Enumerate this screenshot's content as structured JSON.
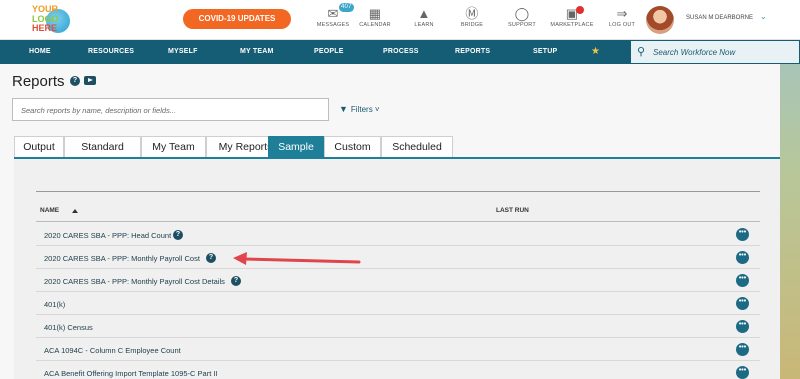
{
  "logo": {
    "line1": "YOUR",
    "line2": "LOGO",
    "line3": "HERE"
  },
  "covid_button": "COVID-19 UPDATES",
  "top_icons": [
    {
      "label": "MESSAGES",
      "icon": "inbox-icon",
      "badge": "407"
    },
    {
      "label": "CALENDAR",
      "icon": "calendar-icon"
    },
    {
      "label": "LEARN",
      "icon": "graduation-cap-icon"
    },
    {
      "label": "BRIDGE",
      "icon": "bridge-icon"
    },
    {
      "label": "SUPPORT",
      "icon": "support-chat-icon"
    },
    {
      "label": "MARKETPLACE",
      "icon": "marketplace-icon"
    },
    {
      "label": "LOG OUT",
      "icon": "logout-icon"
    }
  ],
  "user": {
    "name": "SUSAN M DEARBORNE"
  },
  "nav": {
    "items": [
      "HOME",
      "RESOURCES",
      "MYSELF",
      "MY TEAM",
      "PEOPLE",
      "PROCESS",
      "REPORTS",
      "SETUP"
    ],
    "search_placeholder": "Search Workforce Now"
  },
  "page": {
    "title": "Reports",
    "search_placeholder": "Search reports by name, description or fields...",
    "filters_label": "Filters"
  },
  "tabs": [
    "Output",
    "Standard",
    "My Team",
    "My Reports",
    "Sample",
    "Custom",
    "Scheduled"
  ],
  "active_tab": "Sample",
  "table": {
    "columns": [
      "NAME",
      "LAST RUN"
    ],
    "rows": [
      {
        "name": "2020 CARES SBA - PPP: Head Count",
        "help": true
      },
      {
        "name": "2020 CARES SBA - PPP: Monthly Payroll Cost",
        "help": true
      },
      {
        "name": "2020 CARES SBA - PPP: Monthly Payroll Cost Details",
        "help": true
      },
      {
        "name": "401(k)",
        "help": false
      },
      {
        "name": "401(k) Census",
        "help": false
      },
      {
        "name": "ACA 1094C - Column C Employee Count",
        "help": false
      },
      {
        "name": "ACA Benefit Offering Import Template 1095-C Part II",
        "help": false
      }
    ]
  },
  "colors": {
    "nav": "#155d74",
    "accent": "#1f7f99",
    "covid": "#f26722",
    "arrow": "#e0454b"
  }
}
